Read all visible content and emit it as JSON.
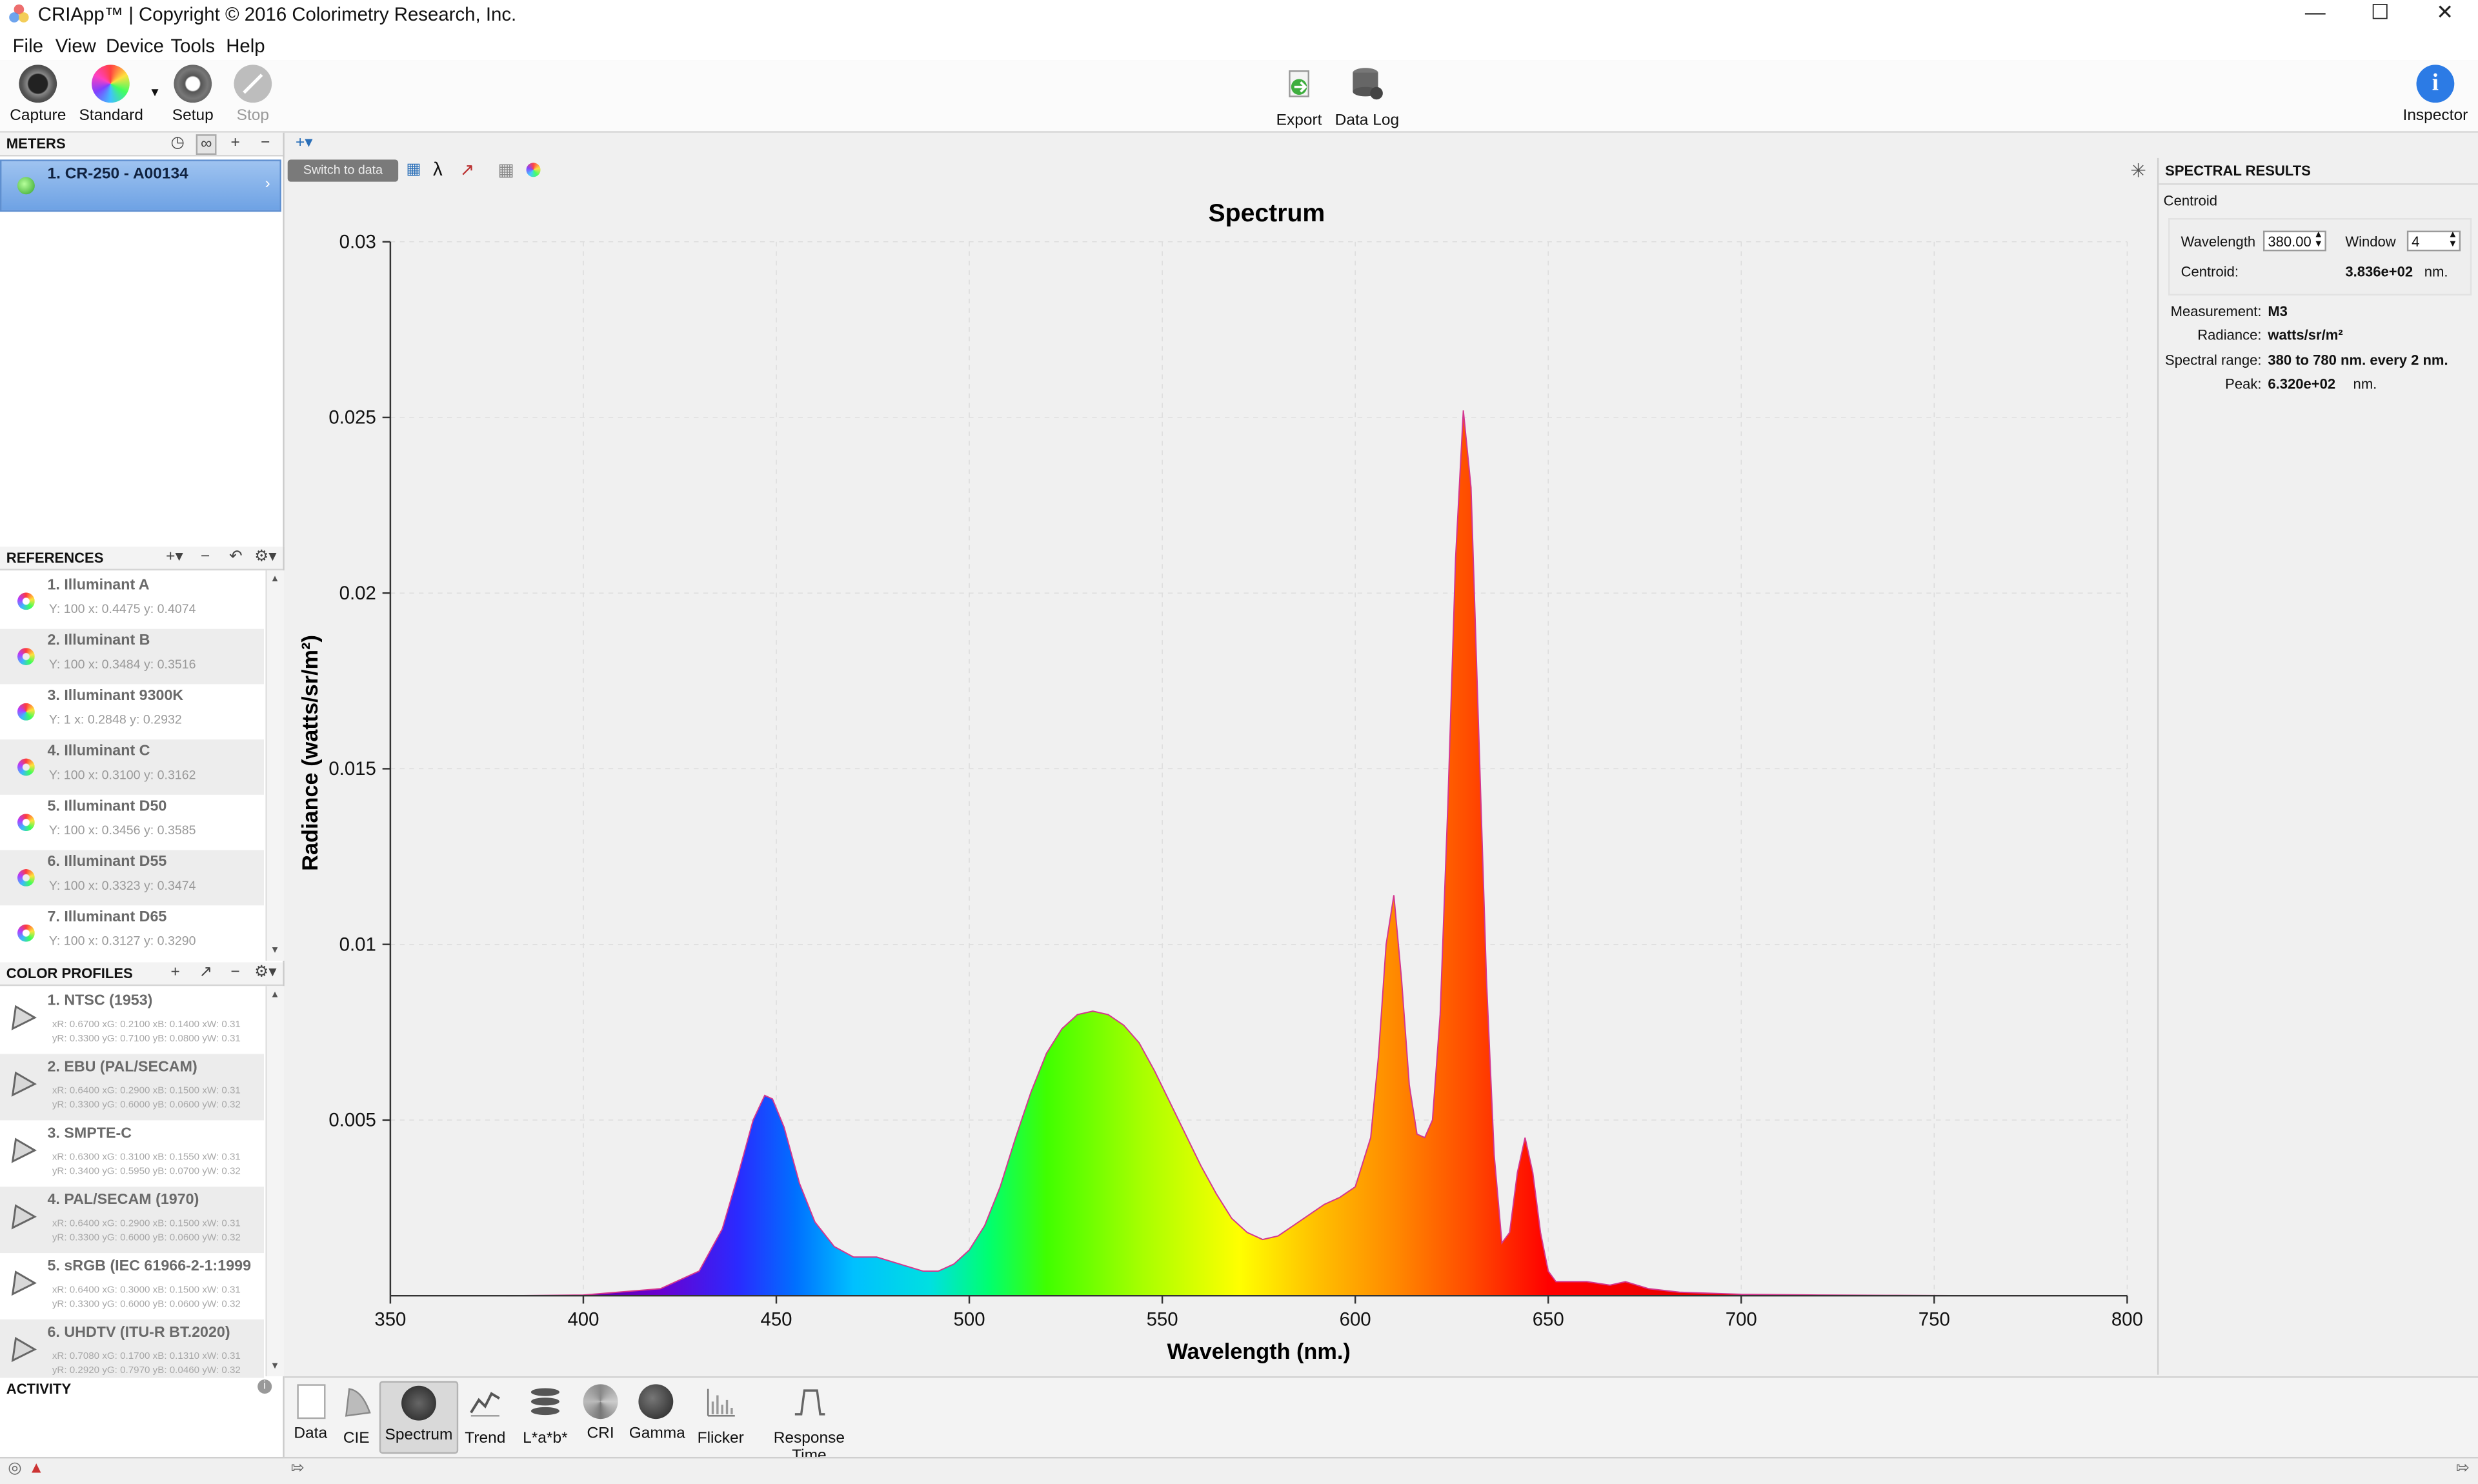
{
  "window": {
    "title": "CRIApp™ | Copyright © 2016 Colorimetry Research, Inc."
  },
  "menu": [
    "File",
    "View",
    "Device",
    "Tools",
    "Help"
  ],
  "toolbar": {
    "capture": "Capture",
    "standard": "Standard",
    "setup": "Setup",
    "stop": "Stop",
    "export": "Export",
    "data_log": "Data Log",
    "inspector": "Inspector"
  },
  "meters": {
    "header": "METERS",
    "items": [
      {
        "name": "1. CR-250 - A00134"
      }
    ]
  },
  "references": {
    "header": "REFERENCES",
    "items": [
      {
        "name": "1. Illuminant A",
        "values": "Y: 100 x: 0.4475 y: 0.4074"
      },
      {
        "name": "2. Illuminant B",
        "values": "Y: 100 x: 0.3484 y: 0.3516"
      },
      {
        "name": "3. Illuminant 9300K",
        "values": "Y: 1 x: 0.2848 y: 0.2932"
      },
      {
        "name": "4. Illuminant C",
        "values": "Y: 100 x: 0.3100 y: 0.3162"
      },
      {
        "name": "5. Illuminant D50",
        "values": "Y: 100 x: 0.3456 y: 0.3585"
      },
      {
        "name": "6. Illuminant D55",
        "values": "Y: 100 x: 0.3323 y: 0.3474"
      },
      {
        "name": "7. Illuminant D65",
        "values": "Y: 100 x: 0.3127 y: 0.3290"
      }
    ]
  },
  "color_profiles": {
    "header": "COLOR PROFILES",
    "items": [
      {
        "name": "1. NTSC (1953)",
        "row1": "xR: 0.6700 xG: 0.2100 xB: 0.1400 xW: 0.31",
        "row2": "yR: 0.3300 yG: 0.7100 yB: 0.0800 yW: 0.31"
      },
      {
        "name": "2. EBU (PAL/SECAM)",
        "row1": "xR: 0.6400 xG: 0.2900 xB: 0.1500 xW: 0.31",
        "row2": "yR: 0.3300 yG: 0.6000 yB: 0.0600 yW: 0.32"
      },
      {
        "name": "3. SMPTE-C",
        "row1": "xR: 0.6300 xG: 0.3100 xB: 0.1550 xW: 0.31",
        "row2": "yR: 0.3400 yG: 0.5950 yB: 0.0700 yW: 0.32"
      },
      {
        "name": "4. PAL/SECAM (1970)",
        "row1": "xR: 0.6400 xG: 0.2900 xB: 0.1500 xW: 0.31",
        "row2": "yR: 0.3300 yG: 0.6000 yB: 0.0600 yW: 0.32"
      },
      {
        "name": "5. sRGB (IEC 61966-2-1:1999",
        "row1": "xR: 0.6400 xG: 0.3000 xB: 0.1500 xW: 0.31",
        "row2": "yR: 0.3300 yG: 0.6000 yB: 0.0600 yW: 0.32"
      },
      {
        "name": "6. UHDTV (ITU-R BT.2020)",
        "row1": "xR: 0.7080 xG: 0.1700 xB: 0.1310 xW: 0.31",
        "row2": "yR: 0.2920 yG: 0.7970 yB: 0.0460 yW: 0.32"
      }
    ]
  },
  "activity": {
    "header": "ACTIVITY"
  },
  "chart_toolbar": {
    "switch": "Switch to data",
    "lambda": "λ"
  },
  "chart_data": {
    "type": "area",
    "title": "Spectrum",
    "xlabel": "Wavelength (nm.)",
    "ylabel": "Radiance (watts/sr/m²)",
    "xlim": [
      350,
      800
    ],
    "ylim": [
      0,
      0.03
    ],
    "xticks": [
      350,
      400,
      450,
      500,
      550,
      600,
      650,
      700,
      750,
      800
    ],
    "yticks": [
      0.005,
      0.01,
      0.015,
      0.02,
      0.025,
      0.03
    ],
    "ytick_labels": [
      "0.005",
      "0.01",
      "0.015",
      "0.02",
      "0.025",
      "0.03"
    ],
    "grid": true,
    "fill": "spectral-rainbow",
    "x": [
      380,
      400,
      420,
      430,
      436,
      440,
      444,
      447,
      449,
      452,
      456,
      460,
      465,
      470,
      476,
      482,
      488,
      492,
      496,
      500,
      504,
      508,
      512,
      516,
      520,
      524,
      528,
      532,
      536,
      540,
      544,
      548,
      552,
      556,
      560,
      564,
      568,
      572,
      576,
      580,
      584,
      588,
      592,
      596,
      600,
      604,
      606,
      608,
      610,
      612,
      614,
      616,
      618,
      620,
      622,
      624,
      626,
      628,
      630,
      632,
      634,
      636,
      638,
      640,
      642,
      644,
      646,
      648,
      650,
      652,
      654,
      656,
      660,
      666,
      670,
      676,
      684,
      700,
      720,
      740,
      760,
      780
    ],
    "y": [
      0,
      2e-05,
      0.0002,
      0.0007,
      0.0019,
      0.0034,
      0.005,
      0.0057,
      0.0056,
      0.0048,
      0.0032,
      0.0021,
      0.0014,
      0.0011,
      0.0011,
      0.0009,
      0.0007,
      0.0007,
      0.0009,
      0.0013,
      0.002,
      0.0031,
      0.0045,
      0.0058,
      0.0069,
      0.0076,
      0.008,
      0.0081,
      0.008,
      0.0077,
      0.0072,
      0.0064,
      0.0055,
      0.0046,
      0.0037,
      0.0029,
      0.0022,
      0.0018,
      0.0016,
      0.0017,
      0.002,
      0.0023,
      0.0026,
      0.0028,
      0.0031,
      0.0045,
      0.0068,
      0.01,
      0.0114,
      0.009,
      0.006,
      0.0046,
      0.0045,
      0.005,
      0.008,
      0.014,
      0.021,
      0.0252,
      0.023,
      0.016,
      0.009,
      0.004,
      0.0015,
      0.0018,
      0.0035,
      0.0045,
      0.0035,
      0.0018,
      0.0007,
      0.0004,
      0.0004,
      0.0004,
      0.0004,
      0.0003,
      0.0004,
      0.0002,
      0.0001,
      4e-05,
      2e-05,
      1e-05,
      0,
      0
    ]
  },
  "spectral_results": {
    "header": "SPECTRAL RESULTS",
    "section": "Centroid",
    "wavelength_label": "Wavelength",
    "wavelength_value": "380.00",
    "window_label": "Window",
    "window_value": "4",
    "centroid_label": "Centroid:",
    "centroid_value": "3.836e+02",
    "centroid_unit": "nm.",
    "measurement_label": "Measurement:",
    "measurement_value": "M3",
    "radiance_label": "Radiance:",
    "radiance_value": "watts/sr/m²",
    "range_label": "Spectral range:",
    "range_value": "380 to 780 nm. every 2 nm.",
    "peak_label": "Peak:",
    "peak_value": "6.320e+02",
    "peak_unit": "nm."
  },
  "bottom_nav": [
    "Data",
    "CIE",
    "Spectrum",
    "Trend",
    "L*a*b*",
    "CRI",
    "Gamma",
    "Flicker",
    "Response Time"
  ]
}
